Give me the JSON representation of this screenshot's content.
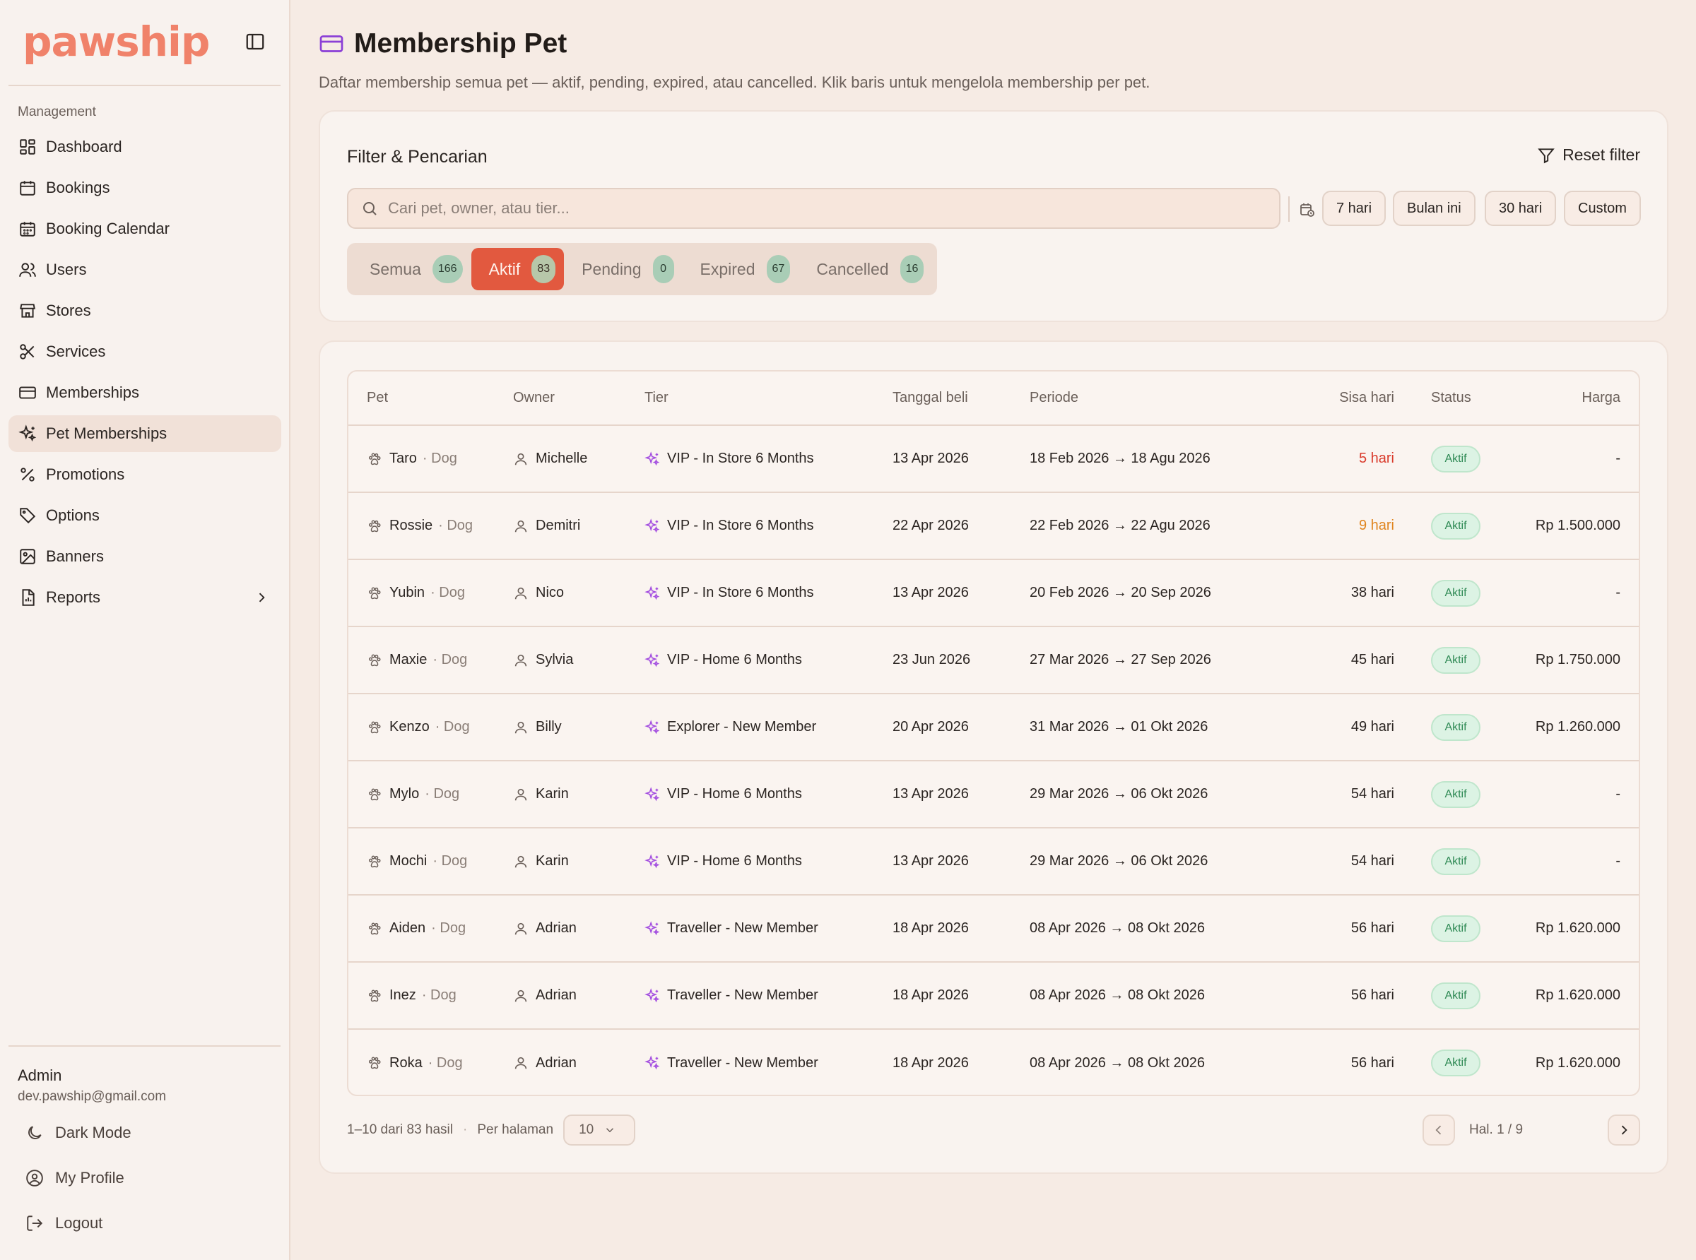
{
  "brand": {
    "logo_text": "pawship",
    "accent": "#e2593f",
    "logo_color": "#f0826a"
  },
  "sidebar": {
    "section_label": "Management",
    "items": [
      {
        "label": "Dashboard",
        "icon": "dashboard-icon"
      },
      {
        "label": "Bookings",
        "icon": "calendar-icon"
      },
      {
        "label": "Booking Calendar",
        "icon": "calendar-grid-icon"
      },
      {
        "label": "Users",
        "icon": "users-icon"
      },
      {
        "label": "Stores",
        "icon": "store-icon"
      },
      {
        "label": "Services",
        "icon": "scissors-icon"
      },
      {
        "label": "Memberships",
        "icon": "card-icon"
      },
      {
        "label": "Pet Memberships",
        "icon": "sparkles-icon",
        "active": true
      },
      {
        "label": "Promotions",
        "icon": "percent-icon"
      },
      {
        "label": "Options",
        "icon": "tag-icon"
      },
      {
        "label": "Banners",
        "icon": "image-icon"
      },
      {
        "label": "Reports",
        "icon": "report-icon"
      }
    ],
    "user": {
      "name": "Admin",
      "email": "dev.pawship@gmail.com"
    },
    "actions": {
      "dark_mode": "Dark Mode",
      "profile": "My Profile",
      "logout": "Logout"
    }
  },
  "header": {
    "title": "Membership Pet",
    "subtitle": "Daftar membership semua pet — aktif, pending, expired, atau cancelled. Klik baris untuk mengelola membership per pet."
  },
  "filter": {
    "title": "Filter & Pencarian",
    "reset_label": "Reset filter",
    "search_placeholder": "Cari pet, owner, atau tier...",
    "search_value": "",
    "ranges": [
      "7 hari",
      "Bulan ini",
      "30 hari",
      "Custom"
    ],
    "tabs": [
      {
        "label": "Semua",
        "count": "166"
      },
      {
        "label": "Aktif",
        "count": "83",
        "active": true
      },
      {
        "label": "Pending",
        "count": "0"
      },
      {
        "label": "Expired",
        "count": "67"
      },
      {
        "label": "Cancelled",
        "count": "16"
      }
    ]
  },
  "table": {
    "columns": [
      "Pet",
      "Owner",
      "Tier",
      "Tanggal beli",
      "Periode",
      "Sisa hari",
      "Status",
      "Harga"
    ],
    "rows": [
      {
        "pet": "Taro",
        "species": "· Dog",
        "owner": "Michelle",
        "tier": "VIP - In Store 6 Months",
        "bought": "13 Apr 2026",
        "period": "18 Feb 2026 → 18 Agu 2026",
        "sisa": "5 hari",
        "sisa_level": "red",
        "status": "Aktif",
        "price": "-"
      },
      {
        "pet": "Rossie",
        "species": "· Dog",
        "owner": "Demitri",
        "tier": "VIP - In Store 6 Months",
        "bought": "22 Apr 2026",
        "period": "22 Feb 2026 → 22 Agu 2026",
        "sisa": "9 hari",
        "sisa_level": "orange",
        "status": "Aktif",
        "price": "Rp 1.500.000"
      },
      {
        "pet": "Yubin",
        "species": "· Dog",
        "owner": "Nico",
        "tier": "VIP - In Store 6 Months",
        "bought": "13 Apr 2026",
        "period": "20 Feb 2026 → 20 Sep 2026",
        "sisa": "38 hari",
        "sisa_level": "normal",
        "status": "Aktif",
        "price": "-"
      },
      {
        "pet": "Maxie",
        "species": "· Dog",
        "owner": "Sylvia",
        "tier": "VIP - Home 6 Months",
        "bought": "23 Jun 2026",
        "period": "27 Mar 2026 → 27 Sep 2026",
        "sisa": "45 hari",
        "sisa_level": "normal",
        "status": "Aktif",
        "price": "Rp 1.750.000"
      },
      {
        "pet": "Kenzo",
        "species": "· Dog",
        "owner": "Billy",
        "tier": "Explorer - New Member",
        "bought": "20 Apr 2026",
        "period": "31 Mar 2026 → 01 Okt 2026",
        "sisa": "49 hari",
        "sisa_level": "normal",
        "status": "Aktif",
        "price": "Rp 1.260.000"
      },
      {
        "pet": "Mylo",
        "species": "· Dog",
        "owner": "Karin",
        "tier": "VIP - Home 6 Months",
        "bought": "13 Apr 2026",
        "period": "29 Mar 2026 → 06 Okt 2026",
        "sisa": "54 hari",
        "sisa_level": "normal",
        "status": "Aktif",
        "price": "-"
      },
      {
        "pet": "Mochi",
        "species": "· Dog",
        "owner": "Karin",
        "tier": "VIP - Home 6 Months",
        "bought": "13 Apr 2026",
        "period": "29 Mar 2026 → 06 Okt 2026",
        "sisa": "54 hari",
        "sisa_level": "normal",
        "status": "Aktif",
        "price": "-"
      },
      {
        "pet": "Aiden",
        "species": "· Dog",
        "owner": "Adrian",
        "tier": "Traveller - New Member",
        "bought": "18 Apr 2026",
        "period": "08 Apr 2026 → 08 Okt 2026",
        "sisa": "56 hari",
        "sisa_level": "normal",
        "status": "Aktif",
        "price": "Rp 1.620.000"
      },
      {
        "pet": "Inez",
        "species": "· Dog",
        "owner": "Adrian",
        "tier": "Traveller - New Member",
        "bought": "18 Apr 2026",
        "period": "08 Apr 2026 → 08 Okt 2026",
        "sisa": "56 hari",
        "sisa_level": "normal",
        "status": "Aktif",
        "price": "Rp 1.620.000"
      },
      {
        "pet": "Roka",
        "species": "· Dog",
        "owner": "Adrian",
        "tier": "Traveller - New Member",
        "bought": "18 Apr 2026",
        "period": "08 Apr 2026 → 08 Okt 2026",
        "sisa": "56 hari",
        "sisa_level": "normal",
        "status": "Aktif",
        "price": "Rp 1.620.000"
      }
    ]
  },
  "pagination": {
    "summary": "1–10 dari 83 hasil",
    "per_page_label": "Per halaman",
    "per_page_value": "10",
    "page_label": "Hal. 1 / 9"
  }
}
